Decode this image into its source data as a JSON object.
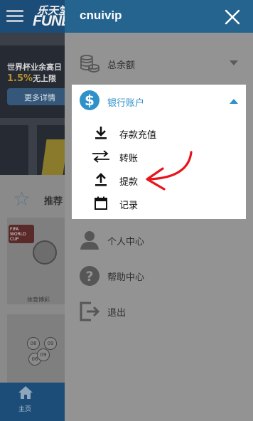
{
  "background_app": {
    "logo_cn": "乐天堂",
    "logo_en": "FUNE",
    "banner": {
      "title": "世界杯业余高日",
      "highlight": "1.5%",
      "highlight_suffix": "无上限",
      "button_label": "更多详情"
    },
    "section_title": "推荐",
    "card_badge": "FIFA WORLD CUP",
    "card_label": "体育博彩",
    "lotto_numbers": [
      "08",
      "09",
      "06",
      "09"
    ],
    "footer_home_label": "主页"
  },
  "drawer": {
    "title": "cnuivip",
    "close_icon": "close-icon",
    "items": [
      {
        "label": "总余额",
        "icon": "coins-icon",
        "expanded": false
      },
      {
        "label": "银行账户",
        "icon": "dollar-circle-icon",
        "expanded": true
      },
      {
        "label": "个人中心",
        "icon": "user-icon"
      },
      {
        "label": "帮助中心",
        "icon": "help-circle-icon"
      },
      {
        "label": "退出",
        "icon": "logout-icon"
      }
    ],
    "bank_submenu": [
      {
        "label": "存款充值",
        "icon": "download-icon"
      },
      {
        "label": "转账",
        "icon": "transfer-arrows-icon"
      },
      {
        "label": "提款",
        "icon": "upload-icon"
      },
      {
        "label": "记录",
        "icon": "calendar-icon"
      }
    ]
  },
  "colors": {
    "header_blue": "#25648f",
    "accent_blue": "#2e92c9",
    "annotation_red": "#e8141b"
  }
}
